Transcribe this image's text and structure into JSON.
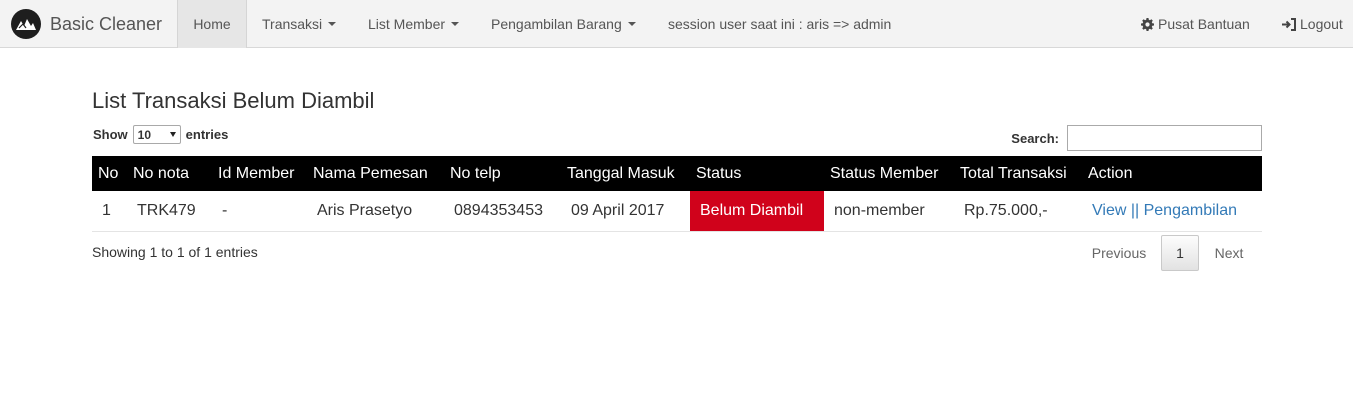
{
  "navbar": {
    "brand": "Basic Cleaner",
    "items": [
      {
        "label": "Home",
        "active": true
      },
      {
        "label": "Transaksi",
        "dropdown": true
      },
      {
        "label": "List Member",
        "dropdown": true
      },
      {
        "label": "Pengambilan Barang",
        "dropdown": true
      }
    ],
    "session_text": "session user saat ini : aris => admin",
    "help_label": "Pusat Bantuan",
    "help_icon": "gear-icon",
    "logout_label": "Logout",
    "logout_icon": "logout-icon"
  },
  "page": {
    "title": "List Transaksi Belum Diambil"
  },
  "length": {
    "show_label": "Show",
    "value": "10",
    "entries_label": "entries"
  },
  "search": {
    "label": "Search:",
    "value": ""
  },
  "table": {
    "headers": [
      "No",
      "No nota",
      "Id Member",
      "Nama Pemesan",
      "No telp",
      "Tanggal Masuk",
      "Status",
      "Status Member",
      "Total Transaksi",
      "Action"
    ],
    "rows": [
      {
        "no": "1",
        "no_nota": "TRK479",
        "id_member": "-",
        "nama": "Aris Prasetyo",
        "telp": "0894353453",
        "tanggal": "09 April 2017",
        "status": "Belum Diambil",
        "status_member": "non-member",
        "total": "Rp.75.000,-",
        "action_view": "View",
        "action_sep": "||",
        "action_pengambilan": "Pengambilan"
      }
    ]
  },
  "info": "Showing 1 to 1 of 1 entries",
  "pagination": {
    "previous": "Previous",
    "current": "1",
    "next": "Next"
  },
  "colors": {
    "navbar_bg": "#f3f3f3",
    "table_header_bg": "#000000",
    "status_bg": "#d0021b",
    "link": "#337ab7"
  }
}
